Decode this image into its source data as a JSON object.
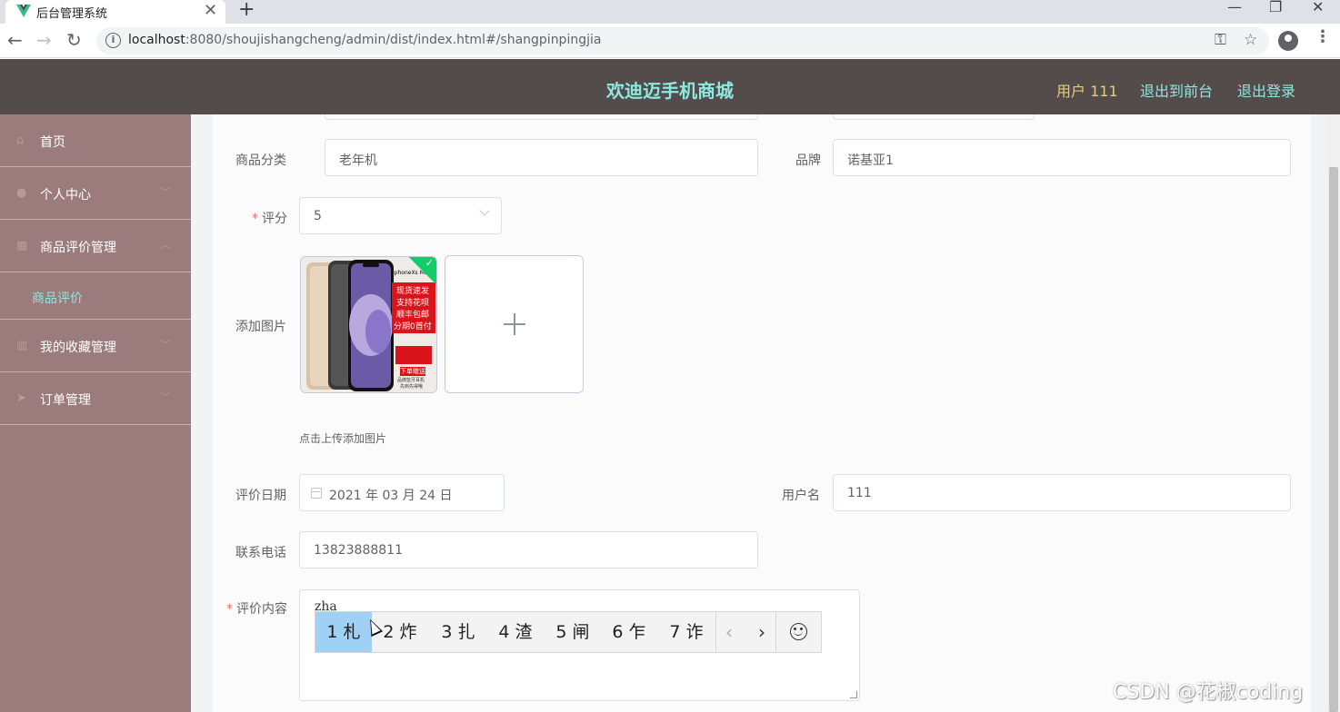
{
  "browser": {
    "tab_title": "后台管理系统",
    "tab_close": "✕",
    "new_tab": "+",
    "url_host": "localhost",
    "url_rest": ":8080/shoujishangcheng/admin/dist/index.html#/shangpinpingjia",
    "window_buttons": [
      "—",
      "❐",
      "✕"
    ]
  },
  "header": {
    "title": "欢迪迈手机商城",
    "user": "用户 111",
    "to_front": "退出到前台",
    "logout": "退出登录"
  },
  "sidebar": {
    "items": [
      {
        "label": "首页"
      },
      {
        "label": "个人中心"
      },
      {
        "label": "商品评价管理"
      },
      {
        "label": "商品评价"
      },
      {
        "label": "我的收藏管理"
      },
      {
        "label": "订单管理"
      }
    ]
  },
  "form": {
    "category_label": "商品分类",
    "category_value": "老年机",
    "brand_label": "品牌",
    "brand_value": "诺基亚1",
    "rating_label": "评分",
    "rating_value": "5",
    "image_label": "添加图片",
    "image_hint": "点击上传添加图片",
    "date_label": "评价日期",
    "date_value": "2021 年 03 月 24 日",
    "username_label": "用户名",
    "username_value": "111",
    "phone_label": "联系电话",
    "phone_value": "13823888811",
    "content_label": "评价内容",
    "content_typed": "zha",
    "required_mark": "*"
  },
  "product_image": {
    "caption": "iphoneXs Max",
    "promo_lines": [
      "现货速发",
      "支持花呗",
      "顺丰包邮",
      "分期0首付"
    ],
    "bottom_banner": "下单赠送",
    "bottom_small": [
      "品牌蓝牙耳机",
      "先到先得哦"
    ]
  },
  "ime": {
    "candidates": [
      "1 札",
      "2 炸",
      "3 扎",
      "4 渣",
      "5 闸",
      "6 乍",
      "7 诈"
    ],
    "prev": "‹",
    "next": "›"
  },
  "watermark": "CSDN @花椒coding"
}
